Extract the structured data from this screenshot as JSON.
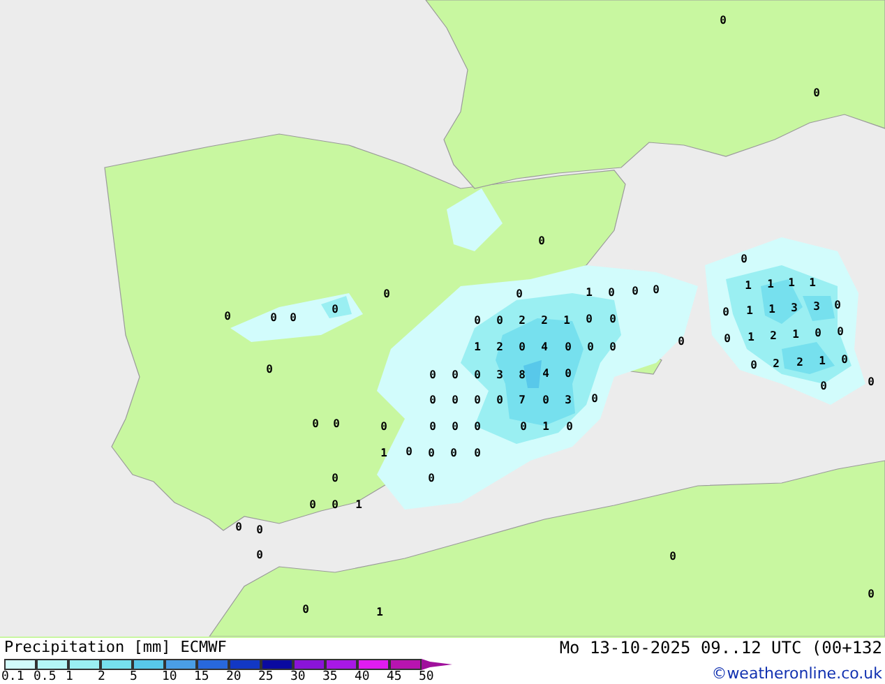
{
  "map": {
    "values": [
      "0",
      "0",
      "0",
      "0",
      "0",
      "0",
      "0",
      "0",
      "0",
      "0",
      "1",
      "0",
      "0",
      "0",
      "1",
      "1",
      "1",
      "1",
      "0",
      "0",
      "2",
      "2",
      "1",
      "0",
      "0",
      "0",
      "1",
      "1",
      "3",
      "3",
      "0",
      "1",
      "2",
      "0",
      "4",
      "0",
      "0",
      "0",
      "0",
      "0",
      "1",
      "2",
      "1",
      "0",
      "0",
      "0",
      "0",
      "0",
      "0",
      "3",
      "8",
      "4",
      "0",
      "0",
      "2",
      "2",
      "1",
      "0",
      "0",
      "0",
      "0",
      "0",
      "0",
      "0",
      "7",
      "0",
      "3",
      "0",
      "0",
      "0",
      "0",
      "0",
      "0",
      "0",
      "0",
      "1",
      "0",
      "1",
      "0",
      "0",
      "0",
      "0",
      "0",
      "0",
      "0",
      "0",
      "1",
      "0",
      "0",
      "0",
      "0",
      "0",
      "1",
      "0"
    ]
  },
  "legend": {
    "title": "Precipitation [mm]",
    "model": "ECMWF",
    "scale": [
      {
        "label": "0.1",
        "color": "#d2fcfc"
      },
      {
        "label": "0.5",
        "color": "#b4f6f6"
      },
      {
        "label": "1",
        "color": "#9aeff2"
      },
      {
        "label": "2",
        "color": "#76e0ee"
      },
      {
        "label": "5",
        "color": "#58c8ea"
      },
      {
        "label": "10",
        "color": "#4a9ee6"
      },
      {
        "label": "15",
        "color": "#2868dc"
      },
      {
        "label": "20",
        "color": "#1238c4"
      },
      {
        "label": "25",
        "color": "#0a0aa0"
      },
      {
        "label": "30",
        "color": "#8a14d8"
      },
      {
        "label": "35",
        "color": "#a818e6"
      },
      {
        "label": "40",
        "color": "#e01cf0"
      },
      {
        "label": "45",
        "color": "#b814b0"
      },
      {
        "label": "50",
        "color": "#a0109c"
      }
    ]
  },
  "valid_time": "Mo 13-10-2025 09..12 UTC (00+132",
  "credit": "©weatheronline.co.uk"
}
